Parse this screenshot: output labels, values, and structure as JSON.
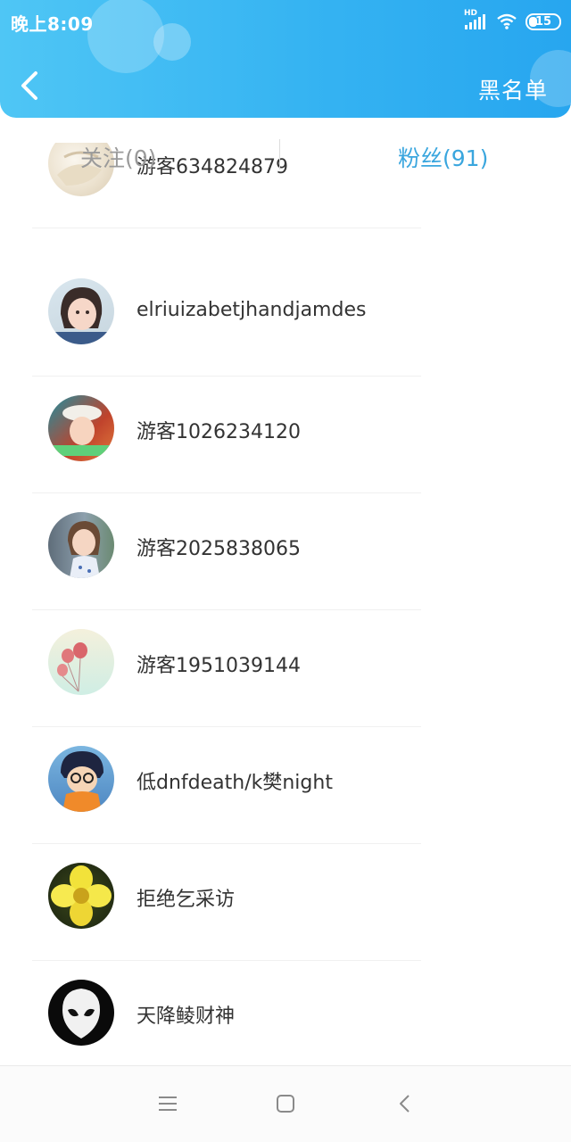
{
  "status_bar": {
    "time": "晚上8:09",
    "network": "HD",
    "battery": "15"
  },
  "header": {
    "back_icon": "chevron-left-icon",
    "blacklist_label": "黑名单",
    "accent_color": "#35b3f2"
  },
  "tabs": {
    "follow_label": "关注(0)",
    "fans_label": "粉丝(91)",
    "active_color": "#3aa6de"
  },
  "fans": [
    {
      "name": "游客634824879",
      "avatar": "avatar-cream-fabric"
    },
    {
      "name": "elriuizabetjhandjamdes",
      "avatar": "avatar-girl-portrait"
    },
    {
      "name": "游客1026234120",
      "avatar": "avatar-girl-hat"
    },
    {
      "name": "游客2025838065",
      "avatar": "avatar-child-photo"
    },
    {
      "name": "游客1951039144",
      "avatar": "avatar-balloons"
    },
    {
      "name": "低dnfdeath/k樊night",
      "avatar": "avatar-cartoon-boy"
    },
    {
      "name": "拒绝乞采访",
      "avatar": "avatar-yellow-flower"
    },
    {
      "name": "天降鲮财神",
      "avatar": "avatar-white-mask"
    }
  ],
  "nav_bar": {
    "menu_icon": "menu-icon",
    "home_icon": "home-square-icon",
    "back_icon": "back-triangle-icon"
  }
}
